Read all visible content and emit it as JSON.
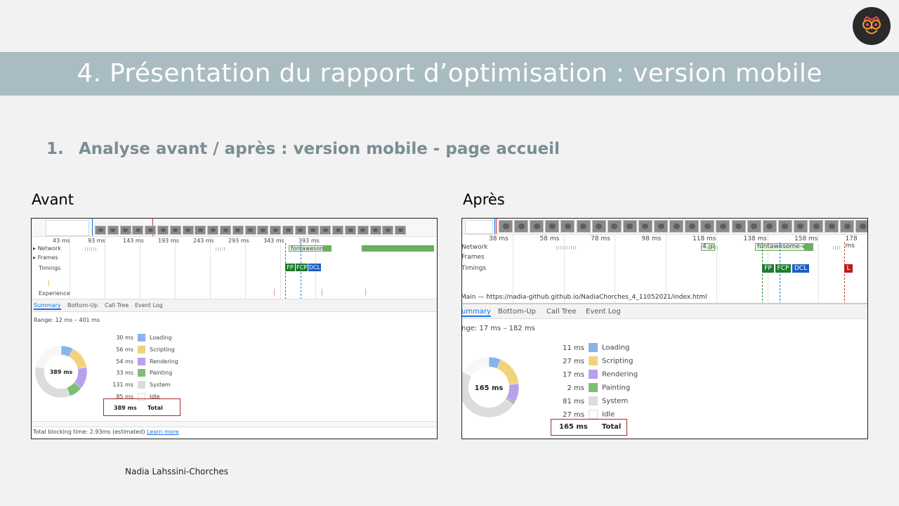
{
  "slide": {
    "title": "4.  Présentation du rapport d’optimisation : version mobile",
    "subtitle_num": "1.",
    "subtitle": "Analyse avant / après :  version mobile - page accueil",
    "author": "Nadia Lahssini-Chorches",
    "logo_icon": "owl-icon"
  },
  "colors": {
    "banner": "#a9bcc1",
    "subtitle": "#7a8d93",
    "loading": "#8ab4e8",
    "scripting": "#f2d27a",
    "rendering": "#b9a0ec",
    "painting": "#7fbf74",
    "system": "#dcdcdc",
    "idle": "#ffffff",
    "total_box": "#a52a2a"
  },
  "before": {
    "label": "Avant",
    "ticks": [
      "43 ms",
      "93 ms",
      "143 ms",
      "193 ms",
      "243 ms",
      "293 ms",
      "343 ms",
      "393 ms"
    ],
    "tracks": [
      "Network",
      "Frames",
      "Timings",
      "Experience"
    ],
    "network_label": "fontawesome",
    "timings": [
      "FP",
      "FCP",
      "DCL"
    ],
    "tabs": [
      "Summary",
      "Bottom-Up",
      "Call Tree",
      "Event Log"
    ],
    "range": "Range: 12 ms – 401 ms",
    "breakdown": [
      {
        "ms": "30 ms",
        "label": "Loading",
        "value": 30
      },
      {
        "ms": "56 ms",
        "label": "Scripting",
        "value": 56
      },
      {
        "ms": "54 ms",
        "label": "Rendering",
        "value": 54
      },
      {
        "ms": "33 ms",
        "label": "Painting",
        "value": 33
      },
      {
        "ms": "131 ms",
        "label": "System",
        "value": 131
      },
      {
        "ms": "85 ms",
        "label": "Idle",
        "value": 85
      }
    ],
    "total_ms": "389 ms",
    "total_label": "Total",
    "donut_center": "389 ms",
    "footer": "Total blocking time: 2.93ms (estimated)",
    "footer_link": "Learn more"
  },
  "after": {
    "label": "Après",
    "ticks": [
      "38 ms",
      "58 ms",
      "78 ms",
      "98 ms",
      "118 ms",
      "138 ms",
      "158 ms",
      "178 ms"
    ],
    "tracks": [
      "Network",
      "Frames",
      "Timings"
    ],
    "network_labels": [
      "4.jp",
      "fontawesome-w..."
    ],
    "timings": [
      "FP",
      "FCP",
      "DCL",
      "L"
    ],
    "main_thread": "Main — https://nadia-github.github.io/NadiaChorches_4_11052021/index.html",
    "tabs": [
      "ummary",
      "Bottom-Up",
      "Call Tree",
      "Event Log"
    ],
    "range": "nge: 17 ms – 182 ms",
    "breakdown": [
      {
        "ms": "11 ms",
        "label": "Loading",
        "value": 11
      },
      {
        "ms": "27 ms",
        "label": "Scripting",
        "value": 27
      },
      {
        "ms": "17 ms",
        "label": "Rendering",
        "value": 17
      },
      {
        "ms": "2 ms",
        "label": "Painting",
        "value": 2
      },
      {
        "ms": "81 ms",
        "label": "System",
        "value": 81
      },
      {
        "ms": "27 ms",
        "label": "Idle",
        "value": 27
      }
    ],
    "total_ms": "165 ms",
    "total_label": "Total",
    "donut_center": "165 ms"
  }
}
